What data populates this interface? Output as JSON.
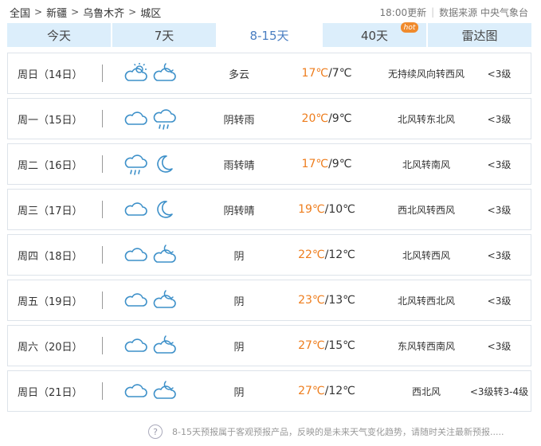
{
  "breadcrumb": {
    "items": [
      "全国",
      "新疆",
      "乌鲁木齐",
      "城区"
    ],
    "separator": ">"
  },
  "meta": {
    "update_time": "18:00更新",
    "source": "数据来源 中央气象台"
  },
  "tabs": [
    {
      "label": "今天",
      "active": false
    },
    {
      "label": "7天",
      "active": false
    },
    {
      "label": "8-15天",
      "active": true
    },
    {
      "label": "40天",
      "active": false,
      "badge": "hot"
    },
    {
      "label": "雷达图",
      "active": false
    }
  ],
  "colors": {
    "tab_bg": "#dceefb",
    "tab_active_text": "#4a7ec1",
    "high_temp": "#ee7d1d",
    "icon_stroke": "#3d90c9",
    "row_border": "#dde3ea"
  },
  "forecast": [
    {
      "day": "周日（14日）",
      "icons": [
        "sunny-cloudy-icon",
        "cloudy-night-icon"
      ],
      "condition": "多云",
      "high": "17℃",
      "low": "/7℃",
      "wind": "无持续风向转西风",
      "level": "<3级"
    },
    {
      "day": "周一（15日）",
      "icons": [
        "cloud-icon",
        "rain-icon"
      ],
      "condition": "阴转雨",
      "high": "20℃",
      "low": "/9℃",
      "wind": "北风转东北风",
      "level": "<3级"
    },
    {
      "day": "周二（16日）",
      "icons": [
        "rain-icon",
        "moon-icon"
      ],
      "condition": "雨转晴",
      "high": "17℃",
      "low": "/9℃",
      "wind": "北风转南风",
      "level": "<3级"
    },
    {
      "day": "周三（17日）",
      "icons": [
        "cloud-icon",
        "moon-icon"
      ],
      "condition": "阴转晴",
      "high": "19℃",
      "low": "/10℃",
      "wind": "西北风转西风",
      "level": "<3级"
    },
    {
      "day": "周四（18日）",
      "icons": [
        "cloud-icon",
        "cloudy-night-icon"
      ],
      "condition": "阴",
      "high": "22℃",
      "low": "/12℃",
      "wind": "北风转西风",
      "level": "<3级"
    },
    {
      "day": "周五（19日）",
      "icons": [
        "cloud-icon",
        "cloudy-night-icon"
      ],
      "condition": "阴",
      "high": "23℃",
      "low": "/13℃",
      "wind": "北风转西北风",
      "level": "<3级"
    },
    {
      "day": "周六（20日）",
      "icons": [
        "cloud-icon",
        "cloudy-night-icon"
      ],
      "condition": "阴",
      "high": "27℃",
      "low": "/15℃",
      "wind": "东风转西南风",
      "level": "<3级"
    },
    {
      "day": "周日（21日）",
      "icons": [
        "cloud-icon",
        "cloudy-night-icon"
      ],
      "condition": "阴",
      "high": "27℃",
      "low": "/12℃",
      "wind": "西北风",
      "level": "<3级转3-4级"
    }
  ],
  "footer": {
    "help_icon": "question-icon",
    "text": "8-15天预报属于客观预报产品，反映的是未来天气变化趋势，请随时关注最新预报....."
  }
}
